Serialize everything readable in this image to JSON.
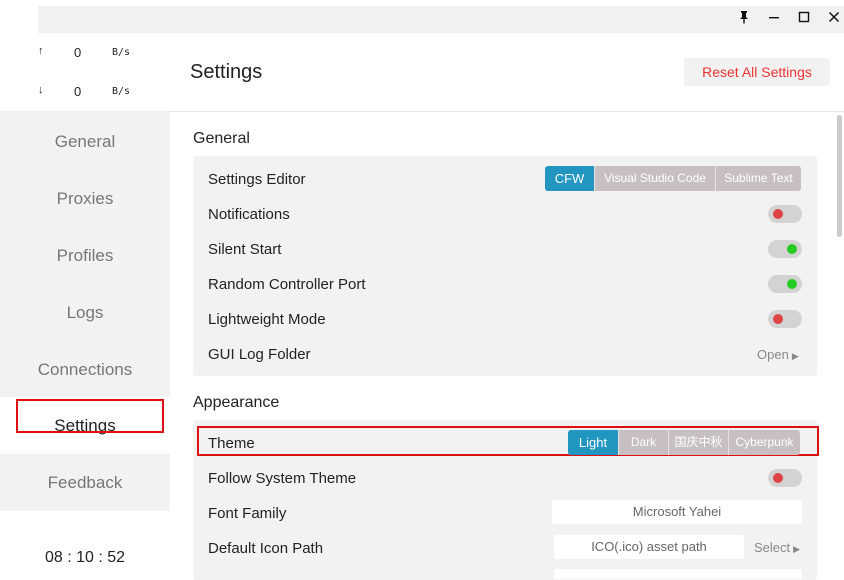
{
  "window": {
    "pin_icon": "pin-icon",
    "minimize_icon": "minimize-icon",
    "maximize_icon": "maximize-icon",
    "close_icon": "close-icon"
  },
  "traffic": {
    "up": {
      "arrow": "↑",
      "value": "0",
      "unit": "B/s"
    },
    "down": {
      "arrow": "↓",
      "value": "0",
      "unit": "B/s"
    }
  },
  "sidebar": {
    "items": [
      {
        "label": "General"
      },
      {
        "label": "Proxies"
      },
      {
        "label": "Profiles"
      },
      {
        "label": "Logs"
      },
      {
        "label": "Connections"
      },
      {
        "label": "Settings"
      },
      {
        "label": "Feedback"
      }
    ],
    "active": "Settings",
    "clock": "08 : 10 : 52"
  },
  "header": {
    "title": "Settings",
    "reset_label": "Reset All Settings"
  },
  "general": {
    "title": "General",
    "settings_editor": {
      "label": "Settings Editor",
      "options": [
        "CFW",
        "Visual Studio Code",
        "Sublime Text"
      ],
      "selected": "CFW"
    },
    "notifications": {
      "label": "Notifications",
      "enabled": false
    },
    "silent_start": {
      "label": "Silent Start",
      "enabled": true
    },
    "random_port": {
      "label": "Random Controller Port",
      "enabled": true
    },
    "lightweight": {
      "label": "Lightweight Mode",
      "enabled": false
    },
    "gui_log": {
      "label": "GUI Log Folder",
      "action": "Open",
      "action_icon": "triangle-right-icon"
    }
  },
  "appearance": {
    "title": "Appearance",
    "theme": {
      "label": "Theme",
      "options": [
        "Light",
        "Dark",
        "国庆中秋",
        "Cyberpunk"
      ],
      "selected": "Light"
    },
    "follow_system": {
      "label": "Follow System Theme",
      "enabled": false
    },
    "font_family": {
      "label": "Font Family",
      "value": "Microsoft Yahei"
    },
    "icon_path": {
      "label": "Default Icon Path",
      "placeholder": "ICO(.ico) asset path",
      "action": "Select",
      "action_icon": "triangle-right-icon"
    }
  },
  "colors": {
    "accent": "#2196c0",
    "toggle_off": "#dd4444",
    "toggle_on": "#22cc22",
    "highlight_box": "#dd1111",
    "reset_text": "#ee3333"
  }
}
